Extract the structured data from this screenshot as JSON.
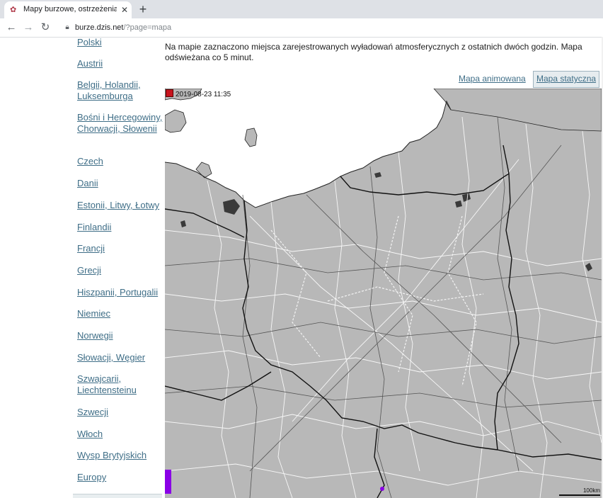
{
  "browser": {
    "tab_title": "Mapy burzowe, ostrzeżenia pogod",
    "tab_close": "✕",
    "new_tab": "+",
    "url_host": "burze.dzis.net",
    "url_path": "/?page=mapa"
  },
  "sidebar": {
    "items": [
      {
        "label": "Polski"
      },
      {
        "label": "Austrii"
      },
      {
        "label": "Belgii, Holandii, Luksemburga"
      },
      {
        "label": "Bośni i Hercegowiny, Chorwacji, Słowenii"
      },
      {
        "label": "Czech"
      },
      {
        "label": "Danii"
      },
      {
        "label": "Estonii, Litwy, Łotwy"
      },
      {
        "label": "Finlandii"
      },
      {
        "label": "Francji"
      },
      {
        "label": "Grecji"
      },
      {
        "label": "Hiszpanii, Portugalii"
      },
      {
        "label": "Niemiec"
      },
      {
        "label": "Norwegii"
      },
      {
        "label": "Słowacji, Węgier"
      },
      {
        "label": "Szwajcarii, Liechtensteinu"
      },
      {
        "label": "Szwecji"
      },
      {
        "label": "Włoch"
      },
      {
        "label": "Wysp Brytyjskich"
      },
      {
        "label": "Europy"
      }
    ]
  },
  "intro_text": "Na mapie zaznaczono miejsca zarejestrowanych wyładowań atmosferycznych z ostatnich dwóch godzin. Mapa odświeżana co 5 minut.",
  "map_tabs": {
    "animated": "Mapa animowana",
    "static": "Mapa statyczna"
  },
  "map": {
    "timestamp": "2019-08-23 11:35",
    "scale_label": "100km",
    "colors": {
      "stamp": "#c8141e",
      "legend": "#8a00e6",
      "strike": "#8a00e6",
      "land": "#b8b8b8",
      "sea": "#ffffff"
    }
  }
}
